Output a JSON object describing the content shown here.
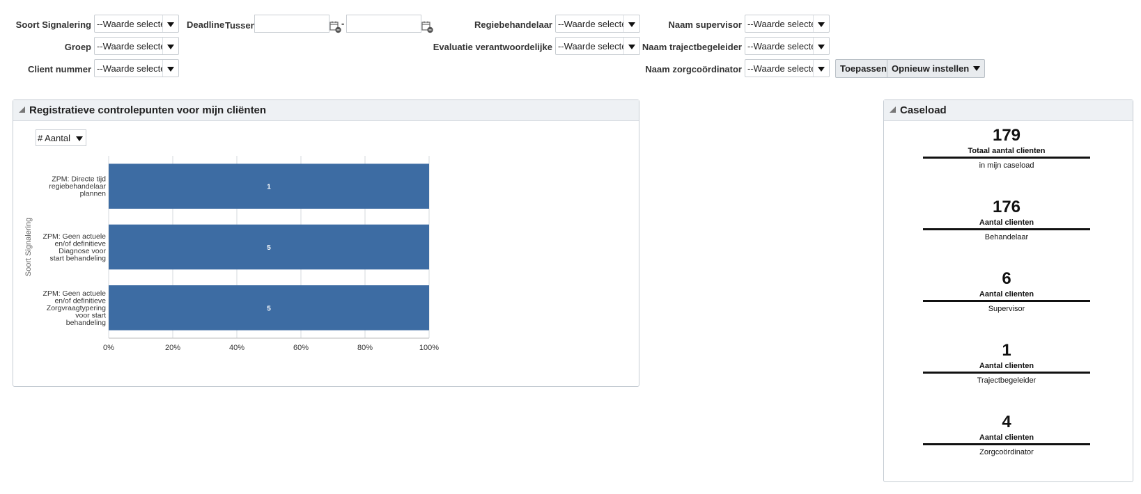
{
  "filters": {
    "soort_signalering": {
      "label": "Soort Signalering",
      "value": "--Waarde selecteren--"
    },
    "groep": {
      "label": "Groep",
      "value": "--Waarde selecteren--"
    },
    "client_nummer": {
      "label": "Client nummer",
      "value": "--Waarde selecteren--"
    },
    "deadline": {
      "label": "Deadline",
      "between_label": "Tussen",
      "from": "",
      "to": "",
      "separator": "-"
    },
    "regiebehandelaar": {
      "label": "Regiebehandelaar",
      "value": "--Waarde selecteren--"
    },
    "evaluatie_verantwoordelijke": {
      "label": "Evaluatie verantwoordelijke",
      "value": "--Waarde selecteren--"
    },
    "naam_supervisor": {
      "label": "Naam supervisor",
      "value": "--Waarde selecteren--"
    },
    "naam_trajectbegeleider": {
      "label": "Naam trajectbegeleider",
      "value": "--Waarde selecteren--"
    },
    "naam_zorgcoordinator": {
      "label": "Naam zorgcoördinator",
      "value": "--Waarde selecteren--"
    },
    "apply_label": "Toepassen",
    "reset_label": "Opnieuw instellen"
  },
  "controls_panel": {
    "title": "Registratieve controlepunten voor mijn cliënten",
    "measure_select": "# Aantal"
  },
  "chart_data": {
    "type": "bar",
    "orientation": "horizontal",
    "stacked_percent": true,
    "categories": [
      "ZPM: Directe tijd regiebehandelaar plannen",
      "ZPM: Geen actuele en/of definitieve Diagnose voor start behandeling",
      "ZPM: Geen actuele en/of definitieve Zorgvraagtypering voor start behandeling"
    ],
    "category_lines": [
      [
        "ZPM: Directe tijd",
        "regiebehandelaar",
        "plannen"
      ],
      [
        "ZPM: Geen actuele",
        "en/of definitieve",
        "Diagnose voor",
        "start behandeling"
      ],
      [
        "ZPM: Geen actuele",
        "en/of definitieve",
        "Zorgvraagtypering",
        "voor start",
        "behandeling"
      ]
    ],
    "values": [
      100,
      100,
      100
    ],
    "data_labels": [
      "1",
      "5",
      "5"
    ],
    "xlim": [
      0,
      100
    ],
    "xticks": [
      "0%",
      "20%",
      "40%",
      "60%",
      "80%",
      "100%"
    ],
    "ylabel": "Soort Signalering",
    "xlabel": "",
    "grid": true,
    "bar_color": "#3d6ca3"
  },
  "caseload": {
    "title": "Caseload",
    "kpis": [
      {
        "value": "179",
        "caption": "Totaal aantal clienten",
        "sub": "in mijn caseload"
      },
      {
        "value": "176",
        "caption": "Aantal clienten",
        "sub": "Behandelaar"
      },
      {
        "value": "6",
        "caption": "Aantal clienten",
        "sub": "Supervisor"
      },
      {
        "value": "1",
        "caption": "Aantal clienten",
        "sub": "Trajectbegeleider"
      },
      {
        "value": "4",
        "caption": "Aantal clienten",
        "sub": "Zorgcoördinator"
      }
    ]
  }
}
